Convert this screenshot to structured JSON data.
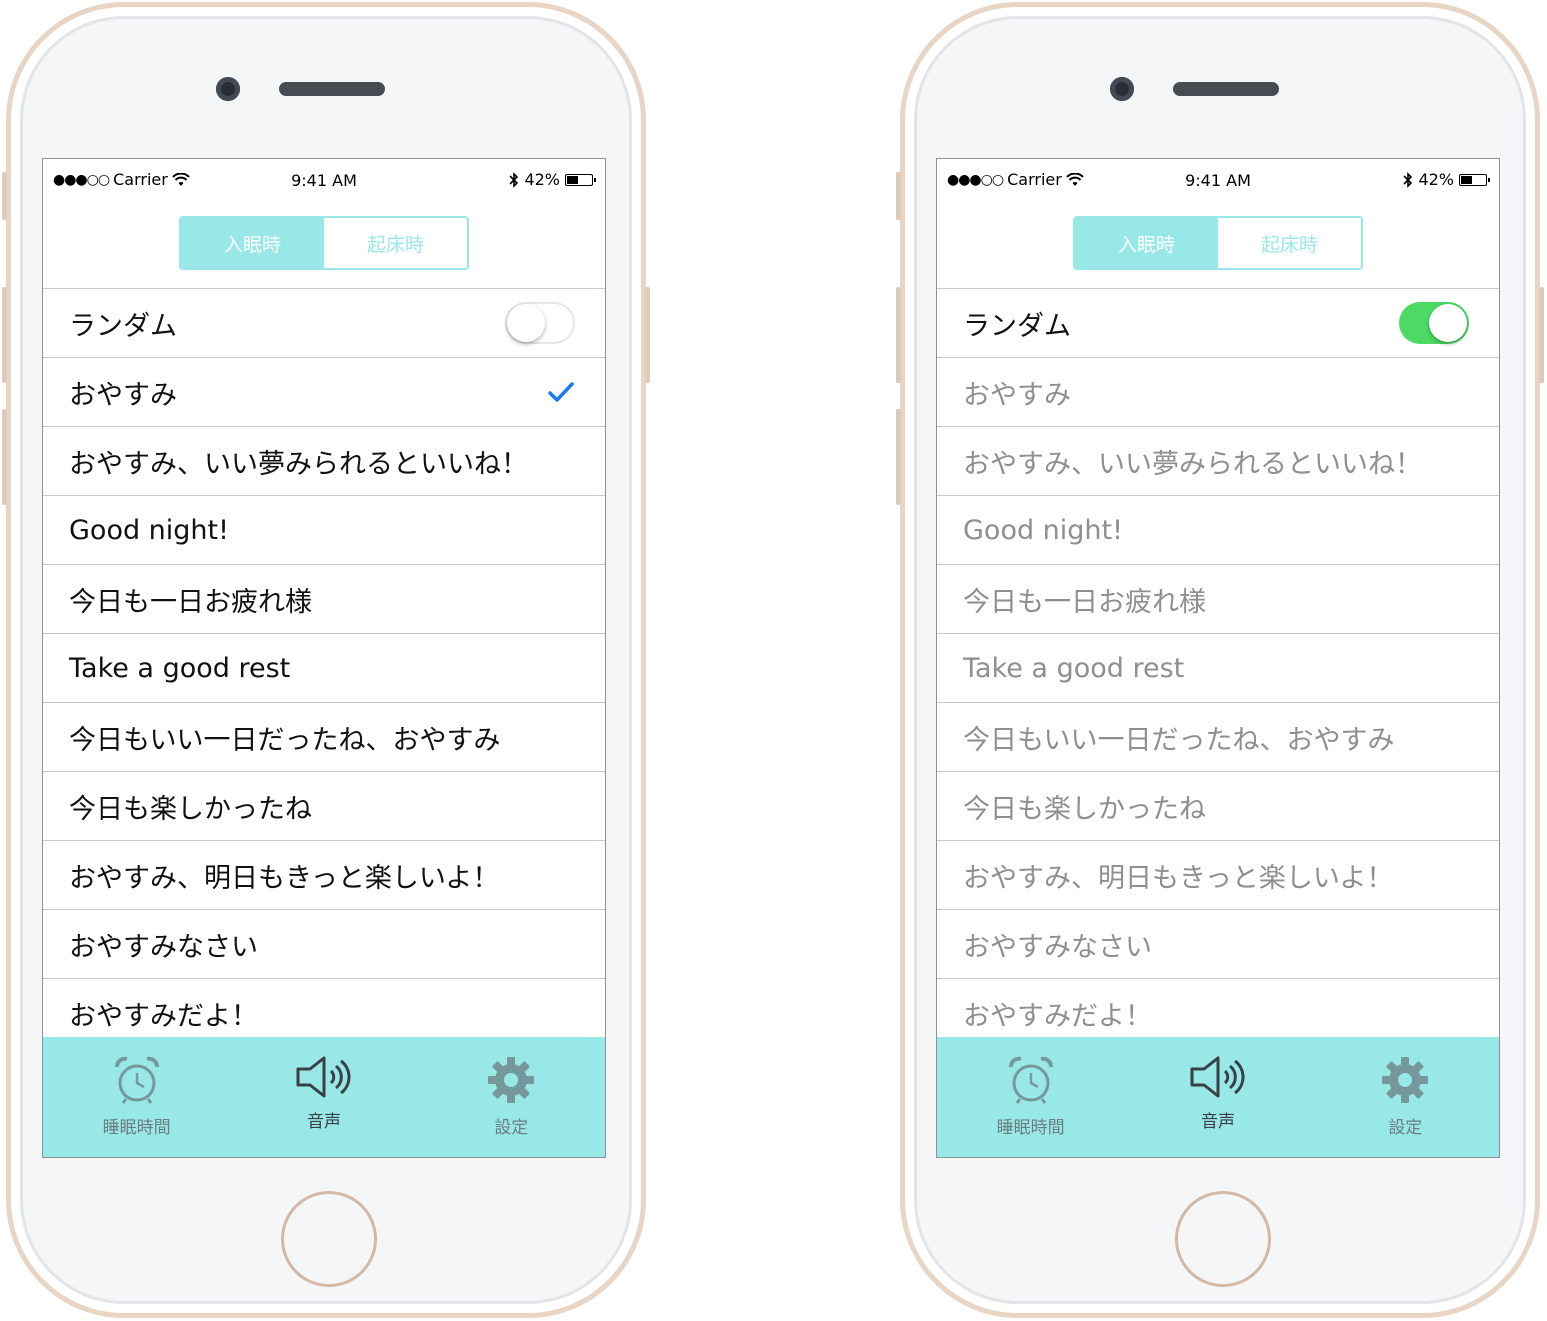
{
  "status_bar": {
    "carrier": "Carrier",
    "signal": "●●●○○",
    "time": "9:41 AM",
    "battery": "42%"
  },
  "segment": {
    "left_label": "入眠時",
    "right_label": "起床時"
  },
  "random_label": "ランダム",
  "phrases": [
    "おやすみ",
    "おやすみ、いい夢みられるといいね！",
    "Good night!",
    "今日も一日お疲れ様",
    "Take a good rest",
    "今日もいい一日だったね、おやすみ",
    "今日も楽しかったね",
    "おやすみ、明日もきっと楽しいよ！",
    "おやすみなさい",
    "おやすみだよ！"
  ],
  "screens": [
    {
      "random_on": false,
      "selected_index": 0
    },
    {
      "random_on": true,
      "selected_index": null
    }
  ],
  "tabs": {
    "sleep_time": {
      "label": "睡眠時間",
      "icon": "alarm-clock-icon"
    },
    "voice": {
      "label": "音声",
      "icon": "speaker-icon"
    },
    "settings": {
      "label": "設定",
      "icon": "gear-icon"
    }
  },
  "colors": {
    "accent": "#99e8e8",
    "tabbar": "#98e8e8",
    "toggle_on": "#4cd964",
    "checkmark": "#1a7cf5"
  }
}
